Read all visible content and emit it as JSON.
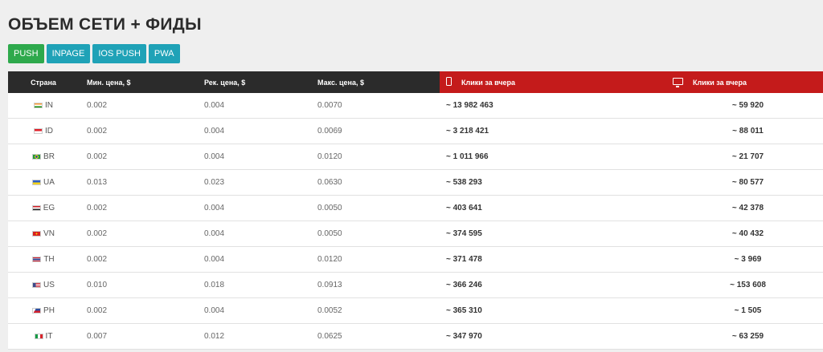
{
  "title": "ОБЪЕМ СЕТИ + ФИДЫ",
  "tabs": [
    {
      "label": "PUSH",
      "active": true
    },
    {
      "label": "INPAGE",
      "active": false
    },
    {
      "label": "IOS PUSH",
      "active": false
    },
    {
      "label": "PWA",
      "active": false
    }
  ],
  "colors": {
    "active_tab": "#2ea94c",
    "tab": "#1fa2b7",
    "header_dark": "#2b2b2b",
    "header_red": "#c41b1b"
  },
  "table": {
    "headers": {
      "country": "Страна",
      "min": "Мин. цена, $",
      "rec": "Рек. цена, $",
      "max": "Макс. цена, $",
      "mobile": "Клики за вчера",
      "mobile_icon": "mobile-phone-icon",
      "desktop": "Клики за вчера",
      "desktop_icon": "desktop-monitor-icon"
    },
    "rows": [
      {
        "country": "IN",
        "min": "0.002",
        "rec": "0.004",
        "max": "0.0070",
        "mobile": "~ 13 982 463",
        "desktop": "~ 59 920"
      },
      {
        "country": "ID",
        "min": "0.002",
        "rec": "0.004",
        "max": "0.0069",
        "mobile": "~ 3 218 421",
        "desktop": "~ 88 011"
      },
      {
        "country": "BR",
        "min": "0.002",
        "rec": "0.004",
        "max": "0.0120",
        "mobile": "~ 1 011 966",
        "desktop": "~ 21 707"
      },
      {
        "country": "UA",
        "min": "0.013",
        "rec": "0.023",
        "max": "0.0630",
        "mobile": "~ 538 293",
        "desktop": "~ 80 577"
      },
      {
        "country": "EG",
        "min": "0.002",
        "rec": "0.004",
        "max": "0.0050",
        "mobile": "~ 403 641",
        "desktop": "~ 42 378"
      },
      {
        "country": "VN",
        "min": "0.002",
        "rec": "0.004",
        "max": "0.0050",
        "mobile": "~ 374 595",
        "desktop": "~ 40 432"
      },
      {
        "country": "TH",
        "min": "0.002",
        "rec": "0.004",
        "max": "0.0120",
        "mobile": "~ 371 478",
        "desktop": "~ 3 969"
      },
      {
        "country": "US",
        "min": "0.010",
        "rec": "0.018",
        "max": "0.0913",
        "mobile": "~ 366 246",
        "desktop": "~ 153 608"
      },
      {
        "country": "PH",
        "min": "0.002",
        "rec": "0.004",
        "max": "0.0052",
        "mobile": "~ 365 310",
        "desktop": "~ 1 505"
      },
      {
        "country": "IT",
        "min": "0.007",
        "rec": "0.012",
        "max": "0.0625",
        "mobile": "~ 347 970",
        "desktop": "~ 63 259"
      }
    ]
  }
}
